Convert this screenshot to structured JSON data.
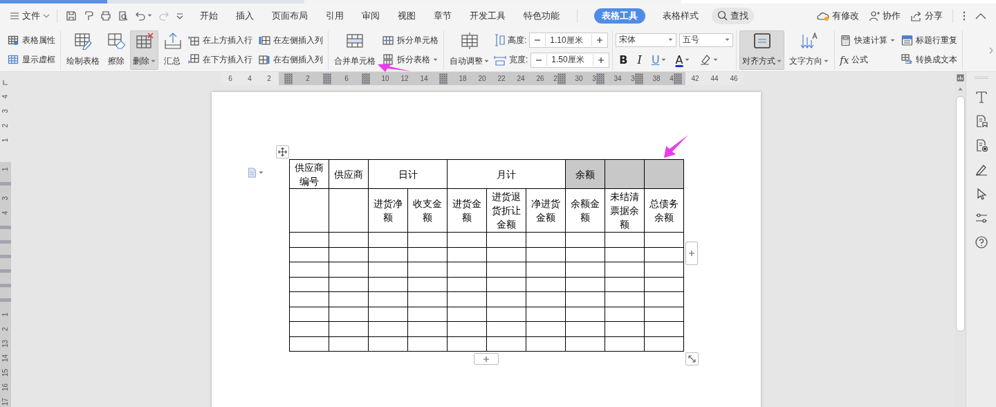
{
  "file_menu": {
    "label": "文件"
  },
  "tabs": [
    {
      "label": "开始",
      "selected": false
    },
    {
      "label": "插入",
      "selected": false
    },
    {
      "label": "页面布局",
      "selected": false
    },
    {
      "label": "引用",
      "selected": false
    },
    {
      "label": "审阅",
      "selected": false
    },
    {
      "label": "视图",
      "selected": false
    },
    {
      "label": "章节",
      "selected": false
    },
    {
      "label": "开发工具",
      "selected": false
    },
    {
      "label": "特色功能",
      "selected": false
    },
    {
      "label": "表格工具",
      "selected": true
    },
    {
      "label": "表格样式",
      "selected": false
    }
  ],
  "search": {
    "label": "查找"
  },
  "actions": [
    {
      "label": "有修改"
    },
    {
      "label": "协作"
    },
    {
      "label": "分享"
    }
  ],
  "ribbon": {
    "groups": [
      {
        "items": [
          {
            "kind": "stack",
            "buttons": [
              {
                "label": "表格属性",
                "dropdown": false
              },
              {
                "label": "显示虚框",
                "dropdown": false
              }
            ]
          }
        ]
      },
      {
        "items": [
          {
            "kind": "large",
            "label": "绘制表格",
            "dropdown": false,
            "pressed": false
          },
          {
            "kind": "large",
            "label": "擦除",
            "dropdown": false,
            "pressed": false
          },
          {
            "kind": "large",
            "label": "删除",
            "dropdown": true,
            "pressed": true
          },
          {
            "kind": "large",
            "label": "汇总",
            "dropdown": false,
            "pressed": false
          },
          {
            "kind": "stack",
            "buttons": [
              {
                "label": "在上方插入行",
                "dropdown": false
              },
              {
                "label": "在下方插入行",
                "dropdown": false
              }
            ]
          },
          {
            "kind": "stack",
            "buttons": [
              {
                "label": "在左侧插入列",
                "dropdown": false
              },
              {
                "label": "在右侧插入列",
                "dropdown": false
              }
            ]
          }
        ]
      },
      {
        "items": [
          {
            "kind": "large",
            "label": "合并单元格",
            "dropdown": false,
            "pressed": false
          },
          {
            "kind": "stack",
            "buttons": [
              {
                "label": "拆分单元格",
                "dropdown": false
              },
              {
                "label": "拆分表格",
                "dropdown": true
              }
            ]
          }
        ]
      },
      {
        "items": [
          {
            "kind": "large",
            "label": "自动调整",
            "dropdown": true,
            "pressed": false
          },
          {
            "kind": "spin",
            "rows": [
              {
                "label": "高度:",
                "value": "1.10厘米"
              },
              {
                "label": "宽度:",
                "value": "1.50厘米"
              }
            ]
          }
        ]
      },
      {
        "items": [
          {
            "kind": "font",
            "family": "宋体",
            "size": "五号",
            "buttons": [
              {
                "text": "B",
                "dropdown": false
              },
              {
                "text": "I",
                "dropdown": false
              },
              {
                "text": "U",
                "dropdown": true
              },
              {
                "text": "A",
                "dropdown": true
              },
              {
                "dropdown": true
              }
            ]
          }
        ]
      },
      {
        "items": [
          {
            "kind": "large",
            "label": "对齐方式",
            "dropdown": true,
            "pressed": true
          },
          {
            "kind": "large",
            "label": "文字方向",
            "dropdown": true,
            "pressed": false
          }
        ]
      },
      {
        "items": [
          {
            "kind": "stack",
            "buttons": [
              {
                "label": "快速计算",
                "dropdown": true
              },
              {
                "label": "公式",
                "icon_text": "fx",
                "dropdown": false
              }
            ]
          },
          {
            "kind": "stack",
            "buttons": [
              {
                "label": "标题行重复",
                "dropdown": false
              },
              {
                "label": "转换成文本",
                "dropdown": false
              }
            ]
          }
        ]
      }
    ]
  },
  "ruler": {
    "marks": [
      {
        "kind": "label",
        "text": "6",
        "shaded": false
      },
      {
        "kind": "label",
        "text": "4",
        "shaded": false
      },
      {
        "kind": "label",
        "text": "2",
        "shaded": false
      },
      {
        "kind": "marker",
        "shaded": true
      },
      {
        "kind": "label",
        "text": "2",
        "shaded": true
      },
      {
        "kind": "marker",
        "shaded": true
      },
      {
        "kind": "label",
        "text": "6",
        "shaded": true
      },
      {
        "kind": "marker",
        "shaded": true
      },
      {
        "kind": "label",
        "text": "10",
        "shaded": true
      },
      {
        "kind": "label",
        "text": "12",
        "shaded": true
      },
      {
        "kind": "label",
        "text": "14",
        "shaded": true
      },
      {
        "kind": "marker",
        "shaded": true
      },
      {
        "kind": "label",
        "text": "18",
        "shaded": true
      },
      {
        "kind": "label",
        "text": "20",
        "shaded": true
      },
      {
        "kind": "label",
        "text": "22",
        "shaded": true
      },
      {
        "kind": "label",
        "text": "24",
        "shaded": true
      },
      {
        "kind": "label",
        "text": "26",
        "shaded": true
      },
      {
        "kind": "cut",
        "text": "2",
        "shaded": true
      },
      {
        "kind": "label",
        "text": "30",
        "shaded": true
      },
      {
        "kind": "cut",
        "text": "3",
        "shaded": true
      },
      {
        "kind": "label",
        "text": "34",
        "shaded": true
      },
      {
        "kind": "cut",
        "text": "3",
        "shaded": true
      },
      {
        "kind": "label",
        "text": "38",
        "shaded": true
      },
      {
        "kind": "cut",
        "text": "4",
        "shaded": true
      },
      {
        "kind": "label",
        "text": "42",
        "shaded": false
      },
      {
        "kind": "label",
        "text": "44",
        "shaded": false
      },
      {
        "kind": "label",
        "text": "46",
        "shaded": false
      }
    ]
  },
  "side_ruler": {
    "marks": [
      {
        "kind": "tab",
        "shaded": false
      },
      {
        "kind": "label",
        "text": "4",
        "shaded": false
      },
      {
        "kind": "label",
        "text": "3",
        "shaded": false
      },
      {
        "kind": "label",
        "text": "2",
        "shaded": false
      },
      {
        "kind": "label",
        "text": "1",
        "shaded": false
      },
      {
        "kind": "blank",
        "shaded": false
      },
      {
        "kind": "label",
        "text": "1",
        "shaded": true
      },
      {
        "kind": "band",
        "shaded": true
      },
      {
        "kind": "label",
        "text": "3",
        "shaded": true
      },
      {
        "kind": "label",
        "text": "4",
        "shaded": true
      },
      {
        "kind": "band",
        "shaded": true
      },
      {
        "kind": "band",
        "shaded": true
      },
      {
        "kind": "band",
        "shaded": true
      },
      {
        "kind": "band",
        "shaded": true
      },
      {
        "kind": "band",
        "shaded": true
      },
      {
        "kind": "band",
        "shaded": true
      },
      {
        "kind": "label",
        "text": "1",
        "shaded": true
      },
      {
        "kind": "label",
        "text": "2",
        "shaded": true
      },
      {
        "kind": "label",
        "text": "13",
        "shaded": true
      },
      {
        "kind": "label",
        "text": "14",
        "shaded": true
      },
      {
        "kind": "label",
        "text": "15",
        "shaded": true
      },
      {
        "kind": "label",
        "text": "16",
        "shaded": true
      },
      {
        "kind": "label",
        "text": "17",
        "shaded": true
      }
    ]
  },
  "table": {
    "header": [
      {
        "text": "供应商编号",
        "shaded": false,
        "sub": [
          {
            "shaded": false
          }
        ]
      },
      {
        "text": "供应商",
        "shaded": false,
        "sub": [
          {
            "shaded": false
          }
        ]
      },
      {
        "text": "日计",
        "shaded": false,
        "sub": [
          {
            "text": "进货净额",
            "shaded": false
          },
          {
            "text": "收支金额",
            "shaded": false
          }
        ]
      },
      {
        "text": "月计",
        "shaded": false,
        "sub": [
          {
            "text": "进货金额",
            "shaded": false
          },
          {
            "text": "进货退货折让金额",
            "shaded": false
          },
          {
            "text": "净进货金额",
            "shaded": false
          }
        ]
      },
      {
        "text": "余额",
        "shaded": true,
        "sub": [
          {
            "text": "余额金额",
            "shaded": false
          }
        ]
      },
      {
        "shaded": true,
        "sub": [
          {
            "text": "未结清票据余额",
            "shaded": false
          }
        ]
      },
      {
        "shaded": true,
        "sub": [
          {
            "text": "总债务余额",
            "shaded": false
          }
        ]
      }
    ],
    "rows": [
      [
        {
          "shaded": false
        },
        {
          "shaded": false
        },
        {
          "shaded": false
        },
        {
          "shaded": false
        },
        {
          "shaded": false
        },
        {
          "shaded": false
        },
        {
          "shaded": false
        },
        {
          "shaded": false
        },
        {
          "shaded": false
        },
        {
          "shaded": false
        }
      ],
      [
        {
          "shaded": false
        },
        {
          "shaded": false
        },
        {
          "shaded": false
        },
        {
          "shaded": false
        },
        {
          "shaded": false
        },
        {
          "shaded": false
        },
        {
          "shaded": false
        },
        {
          "shaded": false
        },
        {
          "shaded": false
        },
        {
          "shaded": false
        }
      ],
      [
        {
          "shaded": false
        },
        {
          "shaded": false
        },
        {
          "shaded": false
        },
        {
          "shaded": false
        },
        {
          "shaded": false
        },
        {
          "shaded": false
        },
        {
          "shaded": false
        },
        {
          "shaded": false
        },
        {
          "shaded": false
        },
        {
          "shaded": false
        }
      ],
      [
        {
          "shaded": false
        },
        {
          "shaded": false
        },
        {
          "shaded": false
        },
        {
          "shaded": false
        },
        {
          "shaded": false
        },
        {
          "shaded": false
        },
        {
          "shaded": false
        },
        {
          "shaded": false
        },
        {
          "shaded": false
        },
        {
          "shaded": false
        }
      ],
      [
        {
          "shaded": false
        },
        {
          "shaded": false
        },
        {
          "shaded": false
        },
        {
          "shaded": false
        },
        {
          "shaded": false
        },
        {
          "shaded": false
        },
        {
          "shaded": false
        },
        {
          "shaded": false
        },
        {
          "shaded": false
        },
        {
          "shaded": false
        }
      ],
      [
        {
          "shaded": false
        },
        {
          "shaded": false
        },
        {
          "shaded": false
        },
        {
          "shaded": false
        },
        {
          "shaded": false
        },
        {
          "shaded": false
        },
        {
          "shaded": false
        },
        {
          "shaded": false
        },
        {
          "shaded": false
        },
        {
          "shaded": false
        }
      ],
      [
        {
          "shaded": false
        },
        {
          "shaded": false
        },
        {
          "shaded": false
        },
        {
          "shaded": false
        },
        {
          "shaded": false
        },
        {
          "shaded": false
        },
        {
          "shaded": false
        },
        {
          "shaded": false
        },
        {
          "shaded": false
        },
        {
          "shaded": false
        }
      ],
      [
        {
          "shaded": false
        },
        {
          "shaded": false
        },
        {
          "shaded": false
        },
        {
          "shaded": false
        },
        {
          "shaded": false
        },
        {
          "shaded": false
        },
        {
          "shaded": false
        },
        {
          "shaded": false
        },
        {
          "shaded": false
        },
        {
          "shaded": false
        }
      ]
    ]
  }
}
